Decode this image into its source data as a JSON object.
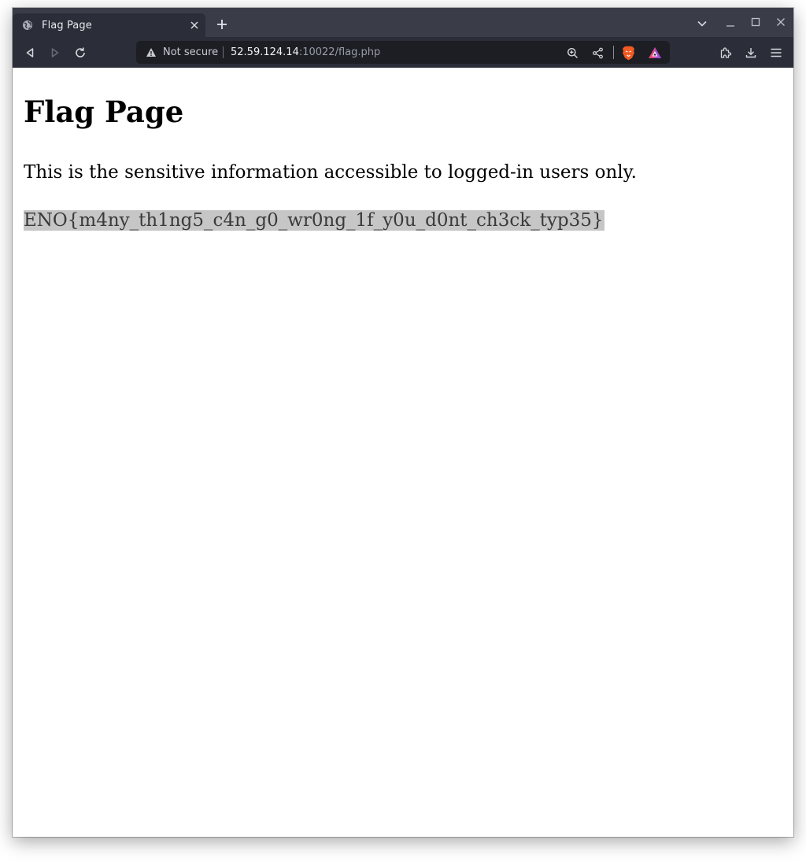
{
  "browser": {
    "tab": {
      "title": "Flag Page",
      "favicon": "globe-icon"
    },
    "toolbar": {
      "security_label": "Not secure",
      "url_host": "52.59.124.14",
      "url_rest": ":10022/flag.php"
    },
    "icons": {
      "back": "back-arrow-icon",
      "forward": "forward-arrow-icon",
      "reload": "reload-icon",
      "zoom": "zoom-icon",
      "share": "share-icon",
      "brave_shields": "brave-lion-icon",
      "brave_rewards": "brave-rewards-icon",
      "extensions": "puzzle-icon",
      "downloads": "download-icon",
      "menu": "hamburger-icon",
      "tab_list": "chevron-down-icon",
      "minimize": "minimize-icon",
      "maximize": "maximize-icon",
      "close": "close-icon",
      "new_tab": "plus-icon"
    },
    "colors": {
      "tabstrip": "#3a3d47",
      "toolbar": "#2b2e38",
      "urlbar": "#1c1e24",
      "brave_orange": "#f15a22",
      "selection": "#c6c6c6"
    }
  },
  "page": {
    "heading": "Flag Page",
    "description": "This is the sensitive information accessible to logged-in users only.",
    "flag": "ENO{m4ny_th1ng5_c4n_g0_wr0ng_1f_y0u_d0nt_ch3ck_typ35}"
  }
}
